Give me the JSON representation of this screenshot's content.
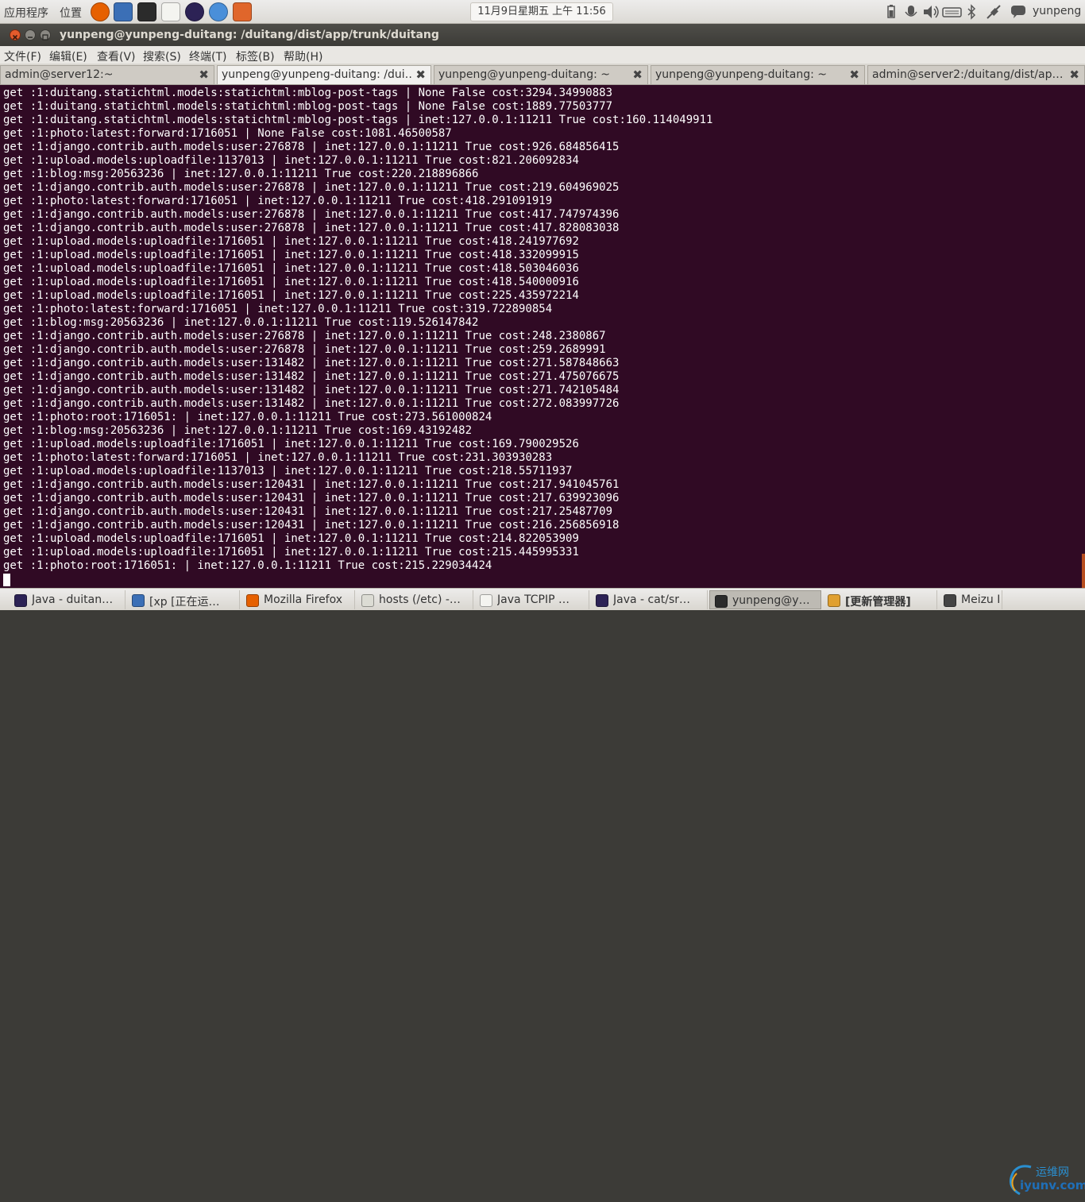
{
  "topbar": {
    "applications": "应用程序",
    "places": "位置",
    "launchers": [
      {
        "icon": "firefox-icon",
        "color": "#e66000"
      },
      {
        "icon": "vmware-icon",
        "color": "#3b6fb6"
      },
      {
        "icon": "terminal-icon",
        "color": "#2b2b2b"
      },
      {
        "icon": "text-editor-icon",
        "color": "#f4f4f0"
      },
      {
        "icon": "eclipse-icon",
        "color": "#2c2255"
      },
      {
        "icon": "chromium-icon",
        "color": "#4a8fd9"
      },
      {
        "icon": "home-folder-icon",
        "color": "#e0662b"
      }
    ],
    "clock": "11月9日星期五 上午 11:56",
    "username": "yunpeng"
  },
  "window": {
    "title": "yunpeng@yunpeng-duitang: /duitang/dist/app/trunk/duitang"
  },
  "menu": [
    "文件(F)",
    "编辑(E)",
    "查看(V)",
    "搜索(S)",
    "终端(T)",
    "标签(B)",
    "帮助(H)"
  ],
  "tabs": [
    {
      "label": "admin@server12:~",
      "active": false
    },
    {
      "label": "yunpeng@yunpeng-duitang: /dui…",
      "active": true
    },
    {
      "label": "yunpeng@yunpeng-duitang: ~",
      "active": false
    },
    {
      "label": "yunpeng@yunpeng-duitang: ~",
      "active": false
    },
    {
      "label": "admin@server2:/duitang/dist/ap…",
      "active": false
    }
  ],
  "terminal": {
    "background": "#300a24",
    "lines": [
      "get :1:duitang.statichtml.models:statichtml:mblog-post-tags | None False cost:3294.34990883",
      "get :1:duitang.statichtml.models:statichtml:mblog-post-tags | None False cost:1889.77503777",
      "get :1:duitang.statichtml.models:statichtml:mblog-post-tags | inet:127.0.0.1:11211 True cost:160.114049911",
      "get :1:photo:latest:forward:1716051 | None False cost:1081.46500587",
      "get :1:django.contrib.auth.models:user:276878 | inet:127.0.0.1:11211 True cost:926.684856415",
      "get :1:upload.models:uploadfile:1137013 | inet:127.0.0.1:11211 True cost:821.206092834",
      "get :1:blog:msg:20563236 | inet:127.0.0.1:11211 True cost:220.218896866",
      "get :1:django.contrib.auth.models:user:276878 | inet:127.0.0.1:11211 True cost:219.604969025",
      "get :1:photo:latest:forward:1716051 | inet:127.0.0.1:11211 True cost:418.291091919",
      "get :1:django.contrib.auth.models:user:276878 | inet:127.0.0.1:11211 True cost:417.747974396",
      "get :1:django.contrib.auth.models:user:276878 | inet:127.0.0.1:11211 True cost:417.828083038",
      "get :1:upload.models:uploadfile:1716051 | inet:127.0.0.1:11211 True cost:418.241977692",
      "get :1:upload.models:uploadfile:1716051 | inet:127.0.0.1:11211 True cost:418.332099915",
      "get :1:upload.models:uploadfile:1716051 | inet:127.0.0.1:11211 True cost:418.503046036",
      "get :1:upload.models:uploadfile:1716051 | inet:127.0.0.1:11211 True cost:418.540000916",
      "get :1:upload.models:uploadfile:1716051 | inet:127.0.0.1:11211 True cost:225.435972214",
      "get :1:photo:latest:forward:1716051 | inet:127.0.0.1:11211 True cost:319.722890854",
      "get :1:blog:msg:20563236 | inet:127.0.0.1:11211 True cost:119.526147842",
      "get :1:django.contrib.auth.models:user:276878 | inet:127.0.0.1:11211 True cost:248.2380867",
      "get :1:django.contrib.auth.models:user:276878 | inet:127.0.0.1:11211 True cost:259.2689991",
      "get :1:django.contrib.auth.models:user:131482 | inet:127.0.0.1:11211 True cost:271.587848663",
      "get :1:django.contrib.auth.models:user:131482 | inet:127.0.0.1:11211 True cost:271.475076675",
      "get :1:django.contrib.auth.models:user:131482 | inet:127.0.0.1:11211 True cost:271.742105484",
      "get :1:django.contrib.auth.models:user:131482 | inet:127.0.0.1:11211 True cost:272.083997726",
      "get :1:photo:root:1716051: | inet:127.0.0.1:11211 True cost:273.561000824",
      "get :1:blog:msg:20563236 | inet:127.0.0.1:11211 True cost:169.43192482",
      "get :1:upload.models:uploadfile:1716051 | inet:127.0.0.1:11211 True cost:169.790029526",
      "get :1:photo:latest:forward:1716051 | inet:127.0.0.1:11211 True cost:231.303930283",
      "get :1:upload.models:uploadfile:1137013 | inet:127.0.0.1:11211 True cost:218.55711937",
      "get :1:django.contrib.auth.models:user:120431 | inet:127.0.0.1:11211 True cost:217.941045761",
      "get :1:django.contrib.auth.models:user:120431 | inet:127.0.0.1:11211 True cost:217.639923096",
      "get :1:django.contrib.auth.models:user:120431 | inet:127.0.0.1:11211 True cost:217.25487709",
      "get :1:django.contrib.auth.models:user:120431 | inet:127.0.0.1:11211 True cost:216.256856918",
      "get :1:upload.models:uploadfile:1716051 | inet:127.0.0.1:11211 True cost:214.822053909",
      "get :1:upload.models:uploadfile:1716051 | inet:127.0.0.1:11211 True cost:215.445995331",
      "get :1:photo:root:1716051: | inet:127.0.0.1:11211 True cost:215.229034424"
    ]
  },
  "taskbar": [
    {
      "label": "Java - duitan…",
      "icon": "eclipse-icon",
      "color": "#2c2255",
      "active": false
    },
    {
      "label": "[xp [正在运…",
      "icon": "vmware-icon",
      "color": "#3b6fb6",
      "active": false
    },
    {
      "label": "Mozilla Firefox",
      "icon": "firefox-icon",
      "color": "#e66000",
      "active": false
    },
    {
      "label": "hosts (/etc) -…",
      "icon": "text-editor-icon",
      "color": "#dcdcd4",
      "active": false
    },
    {
      "label": "Java  TCPIP  …",
      "icon": "document-icon",
      "color": "#f4f4f0",
      "active": false
    },
    {
      "label": "Java - cat/sr…",
      "icon": "eclipse-icon",
      "color": "#2c2255",
      "active": false
    },
    {
      "label": "yunpeng@y…",
      "icon": "terminal-icon",
      "color": "#2b2b2b",
      "active": true
    },
    {
      "label": "[更新管理器]",
      "icon": "update-manager-icon",
      "color": "#e0a030",
      "active": false
    },
    {
      "label": "Meizu Mo…",
      "icon": "phone-icon",
      "color": "#444444",
      "active": false
    }
  ],
  "watermark": {
    "text": "运维网",
    "url": "iyunv.com"
  }
}
